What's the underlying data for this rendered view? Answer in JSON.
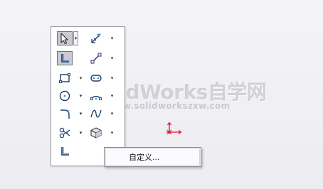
{
  "watermark": {
    "title": "SolidWorks自学网",
    "url": "www.solidworkszxw.com"
  },
  "context_menu": {
    "items": [
      {
        "label": "自定义..."
      }
    ]
  },
  "toolbox": {
    "tools": [
      {
        "icon": "select-arrow-icon",
        "state": "pressed",
        "has_dropdown": true
      },
      {
        "icon": "smart-dimension-icon",
        "state": "normal",
        "has_dropdown": true
      },
      {
        "icon": "sketch-icon",
        "state": "pressed",
        "has_dropdown": false
      },
      {
        "icon": "line-icon",
        "state": "normal",
        "has_dropdown": true
      },
      {
        "icon": "rectangle-icon",
        "state": "normal",
        "has_dropdown": true
      },
      {
        "icon": "slot-icon",
        "state": "normal",
        "has_dropdown": true
      },
      {
        "icon": "circle-icon",
        "state": "normal",
        "has_dropdown": true
      },
      {
        "icon": "arc-icon",
        "state": "normal",
        "has_dropdown": true
      },
      {
        "icon": "fillet-icon",
        "state": "normal",
        "has_dropdown": true
      },
      {
        "icon": "spline-icon",
        "state": "normal",
        "has_dropdown": true
      },
      {
        "icon": "trim-entities-icon",
        "state": "normal",
        "has_dropdown": true
      },
      {
        "icon": "view-cube-icon",
        "state": "normal",
        "has_dropdown": true
      },
      {
        "icon": "exit-sketch-icon",
        "state": "normal",
        "has_dropdown": false
      }
    ]
  },
  "colors": {
    "origin": "#e0102a",
    "icon_stroke": "#1f3a64",
    "icon_accent": "#3e8fd8"
  }
}
